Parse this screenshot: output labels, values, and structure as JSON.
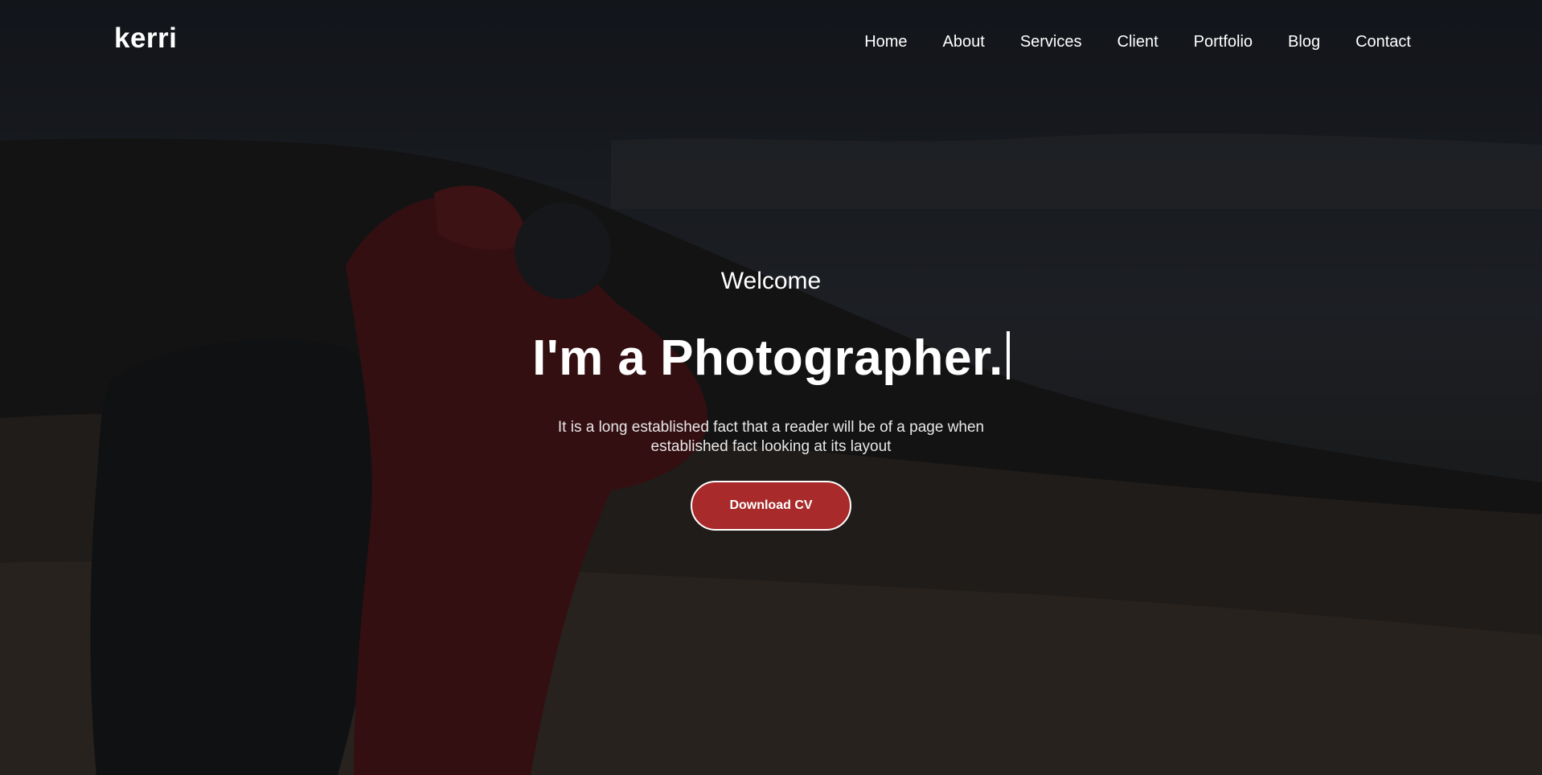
{
  "brand": {
    "name": "kerri"
  },
  "nav": {
    "items": [
      {
        "label": "Home"
      },
      {
        "label": "About"
      },
      {
        "label": "Services"
      },
      {
        "label": "Client"
      },
      {
        "label": "Portfolio"
      },
      {
        "label": "Blog"
      },
      {
        "label": "Contact"
      }
    ]
  },
  "hero": {
    "welcome": "Welcome",
    "headline": "I'm a Photographer.",
    "description": "It is a long established fact that a reader will be of a page when established fact looking at its layout",
    "button_label": "Download CV",
    "accent_color": "#a82a2a"
  }
}
